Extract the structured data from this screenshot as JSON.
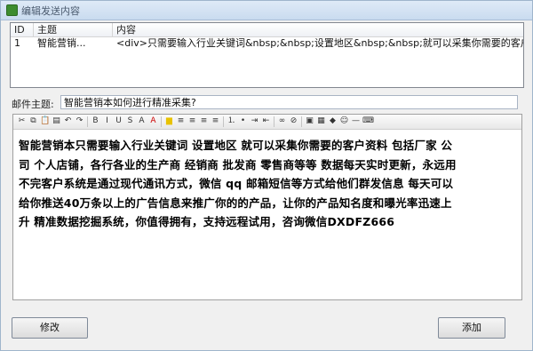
{
  "window": {
    "title": "编辑发送内容",
    "accent": "#c9dbef"
  },
  "list": {
    "columns": [
      "ID",
      "主题",
      "内容"
    ],
    "rows": [
      {
        "id": "1",
        "subject": "智能营销...",
        "content": "<div>只需要输入行业关键词&nbsp;&nbsp;设置地区&nbsp;&nbsp;就可以采集你需要的客户..."
      }
    ]
  },
  "subject": {
    "label": "邮件主题:",
    "value": "智能营销本如何进行精准采集?"
  },
  "toolbar": {
    "icons": [
      "cut-icon",
      "copy-icon",
      "paste-icon",
      "paste-text-icon",
      "undo-icon",
      "redo-icon",
      "bold-icon",
      "italic-icon",
      "underline-icon",
      "strike-icon",
      "font-icon",
      "font-color-icon",
      "bg-color-icon",
      "align-left-icon",
      "align-center-icon",
      "align-right-icon",
      "justify-icon",
      "ordered-list-icon",
      "unordered-list-icon",
      "indent-icon",
      "outdent-icon",
      "link-icon",
      "unlink-icon",
      "image-icon",
      "table-icon",
      "flash-icon",
      "emoticon-icon",
      "hr-icon",
      "source-icon"
    ]
  },
  "editor": {
    "lines": [
      "智能营销本只需要输入行业关键词  设置地区  就可以采集你需要的客户资料   包括厂家  公",
      "司  个人店铺，各行各业的生产商  经销商  批发商  零售商等等   数据每天实时更新，永远用",
      "不完客户系统是通过现代通讯方式，微信   qq   邮箱短信等方式给他们群发信息   每天可以",
      "给你推送40万条以上的广告信息来推广你的的产品，让你的产品知名度和曝光率迅速上",
      "升    精准数据挖掘系统，你值得拥有，支持远程试用，咨询微信DXDFZ666"
    ]
  },
  "buttons": {
    "modify": "修改",
    "add": "添加"
  }
}
